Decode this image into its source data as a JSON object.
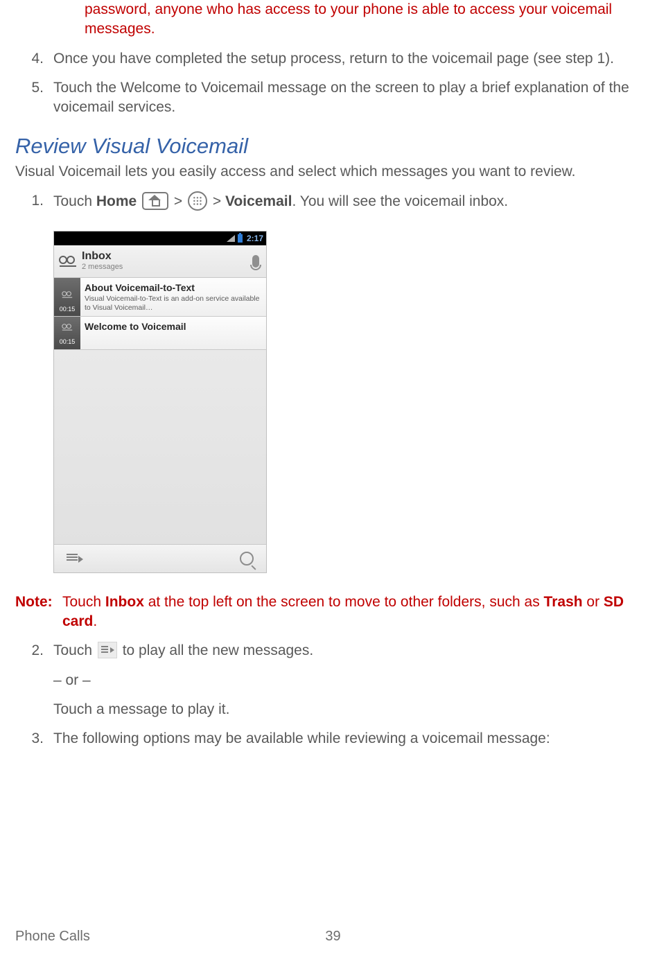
{
  "warning_continuation": "password, anyone who has access to your phone is able to access your voicemail messages.",
  "list_a": {
    "n4": "4.",
    "t4": "Once you have completed the setup process, return to the voicemail page (see step 1).",
    "n5": "5.",
    "t5": "Touch the Welcome to Voicemail message on the screen to play a brief explanation of the voicemail services."
  },
  "section_heading": "Review Visual Voicemail",
  "section_lead": "Visual Voicemail lets you easily access and select which messages you want to review.",
  "list_b": {
    "n1": "1.",
    "t1_a": "Touch ",
    "t1_home": "Home",
    "t1_gt1": " > ",
    "t1_gt2": " > ",
    "t1_vm": "Voicemail",
    "t1_b": ". You will see the voicemail inbox.",
    "n2": "2.",
    "t2_a": "Touch ",
    "t2_b": " to play all the new messages.",
    "t2_or": "– or –",
    "t2_c": "Touch a message to play it.",
    "n3": "3.",
    "t3": "The following options may be available while reviewing a voicemail message:"
  },
  "note": {
    "label": "Note:",
    "a": "Touch ",
    "inbox": "Inbox",
    "b": " at the top left on the screen to move to other folders, such as ",
    "trash": "Trash",
    "c": " or ",
    "sd": "SD card",
    "d": "."
  },
  "phone": {
    "time": "2:17",
    "hd_title": "Inbox",
    "hd_sub": "2 messages",
    "item1_title": "About Voicemail-to-Text",
    "item1_sub": "Visual Voicemail-to-Text is an add-on service available to Visual Voicemail…",
    "item1_dur": "00:15",
    "item2_title": "Welcome to Voicemail",
    "item2_dur": "00:15"
  },
  "footer": {
    "section": "Phone Calls",
    "page": "39"
  }
}
